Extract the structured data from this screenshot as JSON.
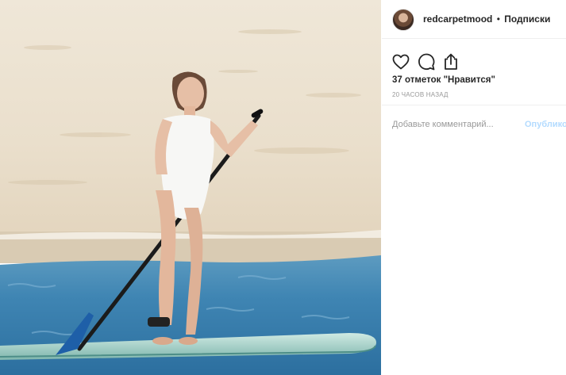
{
  "post": {
    "photo_description_icon": "photo",
    "username": "redcarpetmood",
    "separator": "•",
    "follow_label": "Подписки",
    "likes_text": "37 отметок \"Нравится\"",
    "time_text": "20 ЧАСОВ НАЗАД",
    "comment_placeholder": "Добавьте комментарий...",
    "publish_label": "Опубликовать",
    "icons": [
      "heart-icon",
      "comment-icon",
      "share-icon"
    ],
    "colors": {
      "publish": "#b3dbff",
      "text": "#262626",
      "muted": "#999999",
      "border": "#efefef"
    }
  }
}
